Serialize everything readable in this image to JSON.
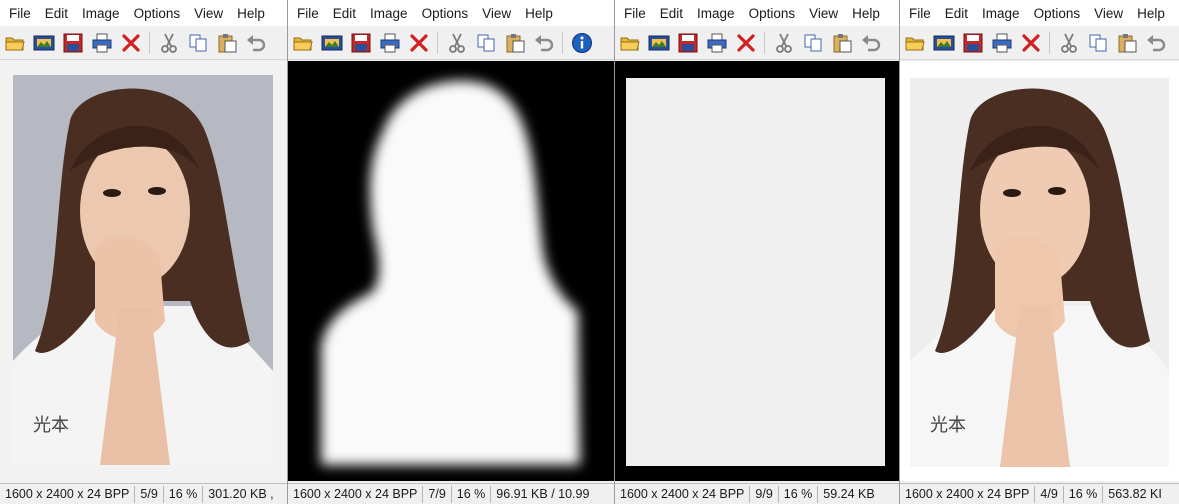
{
  "menu": [
    "File",
    "Edit",
    "Image",
    "Options",
    "View",
    "Help"
  ],
  "panes": [
    {
      "status": [
        "1600 x 2400 x 24 BPP",
        "5/9",
        "16 %",
        "301.20 KB ,"
      ]
    },
    {
      "status": [
        "1600 x 2400 x 24 BPP",
        "7/9",
        "16 %",
        "96.91 KB / 10.99"
      ]
    },
    {
      "status": [
        "1600 x 2400 x 24 BPP",
        "9/9",
        "16 %",
        "59.24 KB"
      ]
    },
    {
      "status": [
        "1600 x 2400 x 24 BPP",
        "4/9",
        "16 %",
        "563.82 KI"
      ]
    }
  ],
  "toolbar_icons": [
    "open-folder-icon",
    "slideshow-icon",
    "save-icon",
    "print-icon",
    "delete-icon",
    "cut-icon",
    "copy-icon",
    "paste-icon",
    "undo-icon",
    "info-icon"
  ],
  "colors": {
    "background": "#f0f0f0",
    "viewer_bg": "#000000",
    "delete_red": "#d21f1f",
    "save_red": "#c62828",
    "info_blue": "#1f5fbf"
  }
}
